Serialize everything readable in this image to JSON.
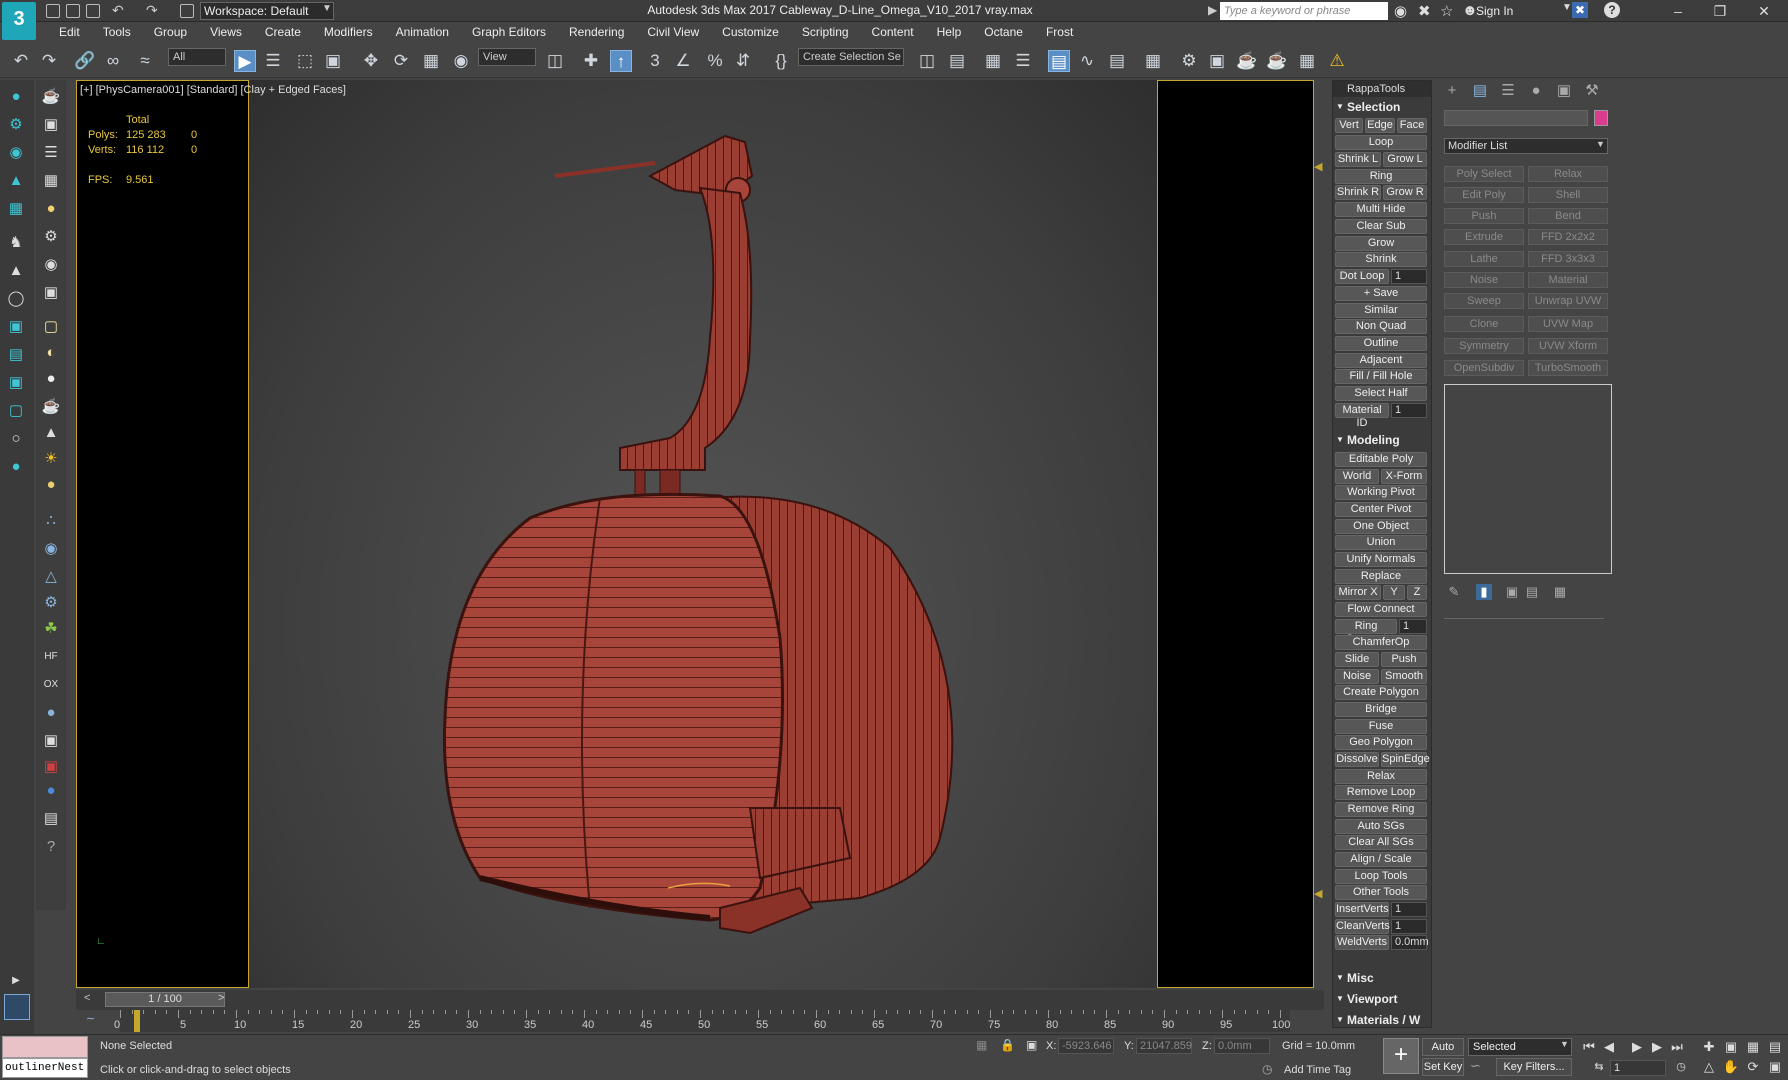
{
  "app": {
    "logo": "3",
    "workspace": "Workspace: Default",
    "title": "Autodesk 3ds Max 2017     Cableway_D-Line_Omega_V10_2017 vray.max",
    "search_placeholder": "Type a keyword or phrase",
    "sign_in": "Sign In"
  },
  "menu": [
    "Edit",
    "Tools",
    "Group",
    "Views",
    "Create",
    "Modifiers",
    "Animation",
    "Graph Editors",
    "Rendering",
    "Civil View",
    "Customize",
    "Scripting",
    "Content",
    "Help",
    "Octane",
    "Frost"
  ],
  "toolbar": {
    "filter": "All",
    "refcoord": "View",
    "selection_set": "Create Selection Se"
  },
  "viewport": {
    "label": "[+] [PhysCamera001] [Standard] [Clay + Edged Faces]",
    "stats_header": "Total",
    "polys_label": "Polys:",
    "polys_total": "125 283",
    "polys_sel": "0",
    "verts_label": "Verts:",
    "verts_total": "116 112",
    "verts_sel": "0",
    "fps_label": "FPS:",
    "fps_value": "9.561"
  },
  "rappa": {
    "title": "RappaTools",
    "selection_header": "Selection",
    "sel": {
      "vert": "Vert",
      "edge": "Edge",
      "face": "Face",
      "loop": "Loop",
      "shrink_l": "Shrink L",
      "grow_l": "Grow L",
      "ring": "Ring",
      "shrink_r": "Shrink R",
      "grow_r": "Grow R",
      "multi_hide": "Multi Hide",
      "clear_sub": "Clear Sub",
      "grow": "Grow",
      "shrink": "Shrink",
      "dot_loop": "Dot Loop",
      "dot_loop_val": "1",
      "save": "+ Save",
      "similar": "Similar",
      "non_quad": "Non Quad",
      "outline": "Outline",
      "adjacent": "Adjacent",
      "fill_hole": "Fill / Fill Hole",
      "select_half": "Select Half",
      "material_id": "Material ID",
      "material_id_val": "1"
    },
    "modeling_header": "Modeling",
    "mod": {
      "editable_poly": "Editable Poly",
      "world": "World",
      "xform": "X-Form",
      "working_pivot": "Working Pivot",
      "center_pivot": "Center Pivot",
      "one_object": "One Object",
      "union": "Union",
      "unify_normals": "Unify Normals",
      "replace": "Replace",
      "mirror_x": "Mirror X",
      "y": "Y",
      "z": "Z",
      "flow_connect": "Flow Connect",
      "ring_connect": "Ring Connect",
      "ring_connect_val": "1",
      "chamferop": "ChamferOp",
      "slide": "Slide",
      "push": "Push",
      "noise": "Noise",
      "smooth": "Smooth",
      "create_polygon": "Create Polygon",
      "bridge": "Bridge",
      "fuse": "Fuse",
      "geo_polygon": "Geo Polygon",
      "dissolve": "Dissolve",
      "spinedge": "SpinEdge",
      "relax": "Relax",
      "remove_loop": "Remove Loop",
      "remove_ring": "Remove Ring",
      "auto_sgs": "Auto SGs",
      "clear_all_sgs": "Clear All SGs",
      "align_scale": "Align / Scale",
      "loop_tools": "Loop Tools",
      "other_tools": "Other Tools",
      "insertverts": "InsertVerts",
      "insertverts_val": "1",
      "cleanverts": "CleanVerts",
      "cleanverts_val": "1",
      "weldverts": "WeldVerts",
      "weldverts_val": "0.0mm"
    },
    "misc_header": "Misc",
    "viewport_header": "Viewport",
    "materials_header": "Materials / W"
  },
  "command_panel": {
    "modifier_list": "Modifier List",
    "buttons": [
      "Poly Select",
      "Relax",
      "Edit Poly",
      "Shell",
      "Push",
      "Bend",
      "Extrude",
      "FFD 2x2x2",
      "Lathe",
      "FFD 3x3x3",
      "Noise",
      "Material",
      "Sweep",
      "Unwrap UVW",
      "Clone",
      "UVW Map",
      "Symmetry",
      "UVW Xform",
      "OpenSubdiv",
      "TurboSmooth"
    ]
  },
  "timeline": {
    "frame": "1 / 100",
    "ticks": [
      "0",
      "5",
      "10",
      "15",
      "20",
      "25",
      "30",
      "35",
      "40",
      "45",
      "50",
      "55",
      "60",
      "65",
      "70",
      "75",
      "80",
      "85",
      "90",
      "95",
      "100"
    ]
  },
  "status": {
    "maxscript": "outlinerNest",
    "none_selected": "None Selected",
    "prompt": "Click or click-and-drag to select objects",
    "x_label": "X:",
    "x_val": "-5923.646",
    "y_label": "Y:",
    "y_val": "21047.859",
    "z_label": "Z:",
    "z_val": "0.0mm",
    "grid": "Grid = 10.0mm",
    "add_time_tag": "Add Time Tag",
    "auto_key": "Auto Key",
    "selected": "Selected",
    "set_key": "Set Key",
    "key_filters": "Key Filters...",
    "current_frame": "1"
  }
}
